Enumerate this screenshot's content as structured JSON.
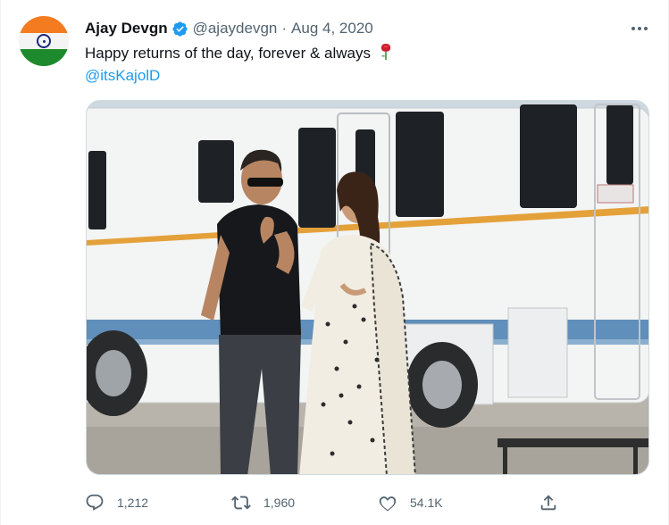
{
  "tweet": {
    "author_name": "Ajay Devgn",
    "handle": "@ajaydevgn",
    "separator": "·",
    "date": "Aug 4, 2020",
    "text": "Happy returns of the day, forever & always",
    "mention": "@itsKajolD",
    "emoji": "rose-emoji",
    "verified": true
  },
  "actions": {
    "replies": "1,212",
    "retweets": "1,960",
    "likes": "54.1K"
  },
  "icons": {
    "verified": "verified-badge-icon",
    "more": "more-options-icon",
    "reply": "reply-icon",
    "retweet": "retweet-icon",
    "like": "like-icon",
    "share": "share-icon"
  },
  "colors": {
    "accent": "#1d9bf0",
    "text": "#0f1419",
    "secondary": "#536471",
    "border": "#cfd9de"
  }
}
